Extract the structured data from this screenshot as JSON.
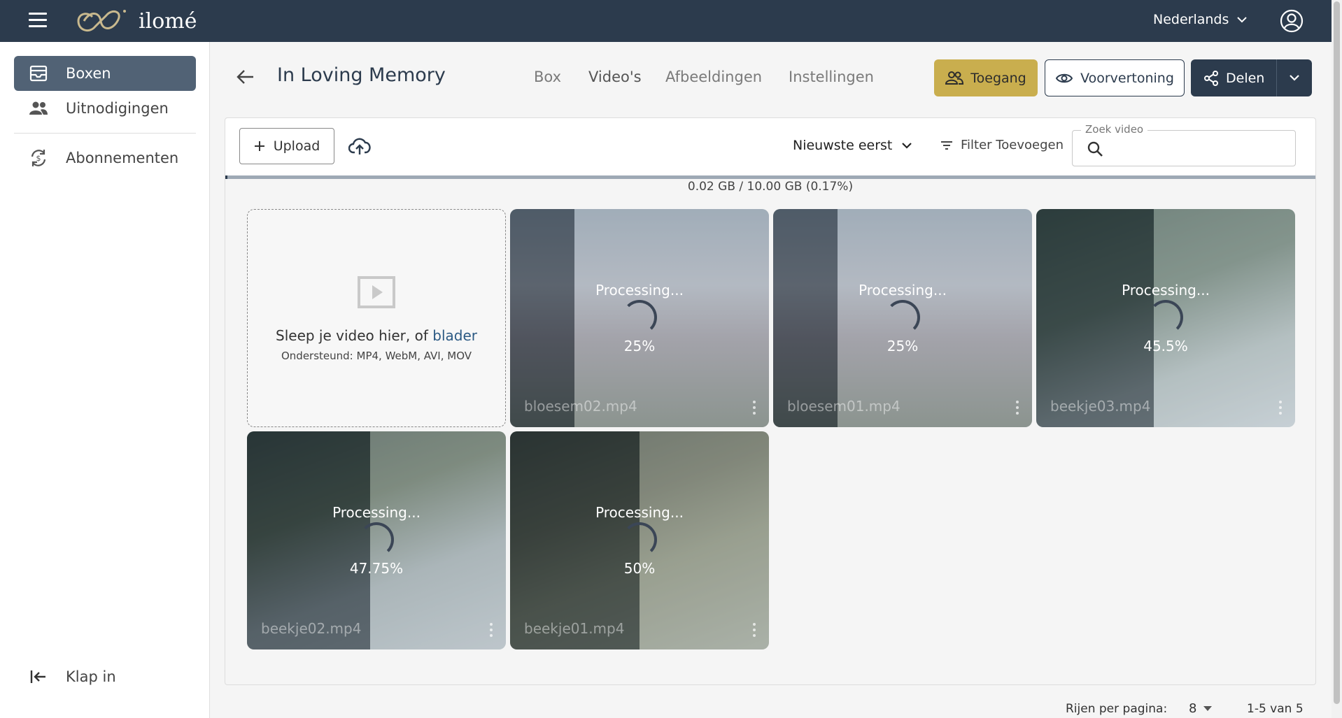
{
  "app": {
    "brand": "ilomé"
  },
  "topbar": {
    "language": "Nederlands"
  },
  "sidebar": {
    "items": [
      {
        "label": "Boxen",
        "icon": "inbox-icon",
        "active": true
      },
      {
        "label": "Uitnodigingen",
        "icon": "people-icon",
        "active": false
      },
      {
        "label": "Abonnementen",
        "icon": "subscription-icon",
        "active": false
      }
    ],
    "collapse_label": "Klap in"
  },
  "header": {
    "title": "In Loving Memory",
    "tabs": [
      {
        "label": "Box",
        "active": false
      },
      {
        "label": "Video's",
        "active": true
      },
      {
        "label": "Afbeeldingen",
        "active": false
      },
      {
        "label": "Instellingen",
        "active": false
      }
    ],
    "access_label": "Toegang",
    "preview_label": "Voorvertoning",
    "share_label": "Delen"
  },
  "toolbar": {
    "upload_label": "Upload",
    "sort_label": "Nieuwste eerst",
    "filter_label": "Filter Toevoegen",
    "search_legend": "Zoek video",
    "search_value": ""
  },
  "storage": {
    "text": "0.02 GB / 10.00 GB (0.17%)",
    "fraction": 0.0017
  },
  "dropzone": {
    "text": "Sleep je video hier, of ",
    "link": "blader",
    "supported": "Ondersteund: MP4, WebM, AVI, MOV"
  },
  "videos": [
    {
      "name": "bloesem02.mp4",
      "status": "Processing...",
      "progress": "25%"
    },
    {
      "name": "bloesem01.mp4",
      "status": "Processing...",
      "progress": "25%"
    },
    {
      "name": "beekje03.mp4",
      "status": "Processing...",
      "progress": "45.5%"
    },
    {
      "name": "beekje02.mp4",
      "status": "Processing...",
      "progress": "47.75%"
    },
    {
      "name": "beekje01.mp4",
      "status": "Processing...",
      "progress": "50%"
    }
  ],
  "pagination": {
    "rows_label": "Rijen per pagina:",
    "rows_value": "8",
    "range": "1-5 van 5"
  },
  "colors": {
    "navy": "#2c3b4d",
    "gold": "#c9ae4e",
    "active_nav": "#516275"
  }
}
